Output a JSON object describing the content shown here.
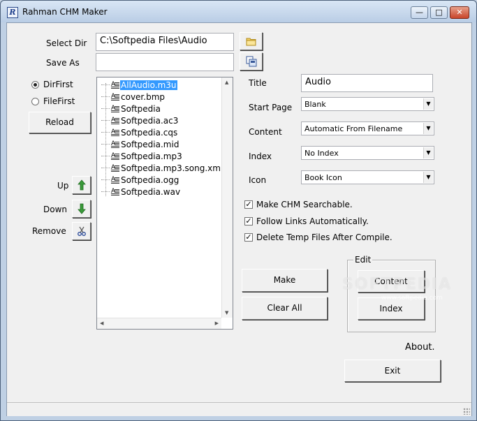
{
  "window": {
    "title": "Rahman CHM Maker",
    "minimize_glyph": "—",
    "maximize_glyph": "□",
    "close_glyph": "✕"
  },
  "left_panel": {
    "select_dir_label": "Select Dir",
    "select_dir_value": "C:\\Softpedia Files\\Audio",
    "save_as_label": "Save As",
    "save_as_value": "",
    "browse_icon": "folder-open-icon",
    "save_icon": "save-copy-icon",
    "sort_options": [
      {
        "label": "DirFirst",
        "selected": true
      },
      {
        "label": "FileFirst",
        "selected": false
      }
    ],
    "reload_label": "Reload",
    "up_label": "Up",
    "down_label": "Down",
    "remove_label": "Remove"
  },
  "file_list": {
    "items": [
      {
        "name": "AllAudio.m3u",
        "selected": true
      },
      {
        "name": "cover.bmp",
        "selected": false
      },
      {
        "name": "Softpedia",
        "selected": false
      },
      {
        "name": "Softpedia.ac3",
        "selected": false
      },
      {
        "name": "Softpedia.cqs",
        "selected": false
      },
      {
        "name": "Softpedia.mid",
        "selected": false
      },
      {
        "name": "Softpedia.mp3",
        "selected": false
      },
      {
        "name": "Softpedia.mp3.song.xml",
        "selected": false
      },
      {
        "name": "Softpedia.ogg",
        "selected": false
      },
      {
        "name": "Softpedia.wav",
        "selected": false
      }
    ]
  },
  "settings": {
    "title_label": "Title",
    "title_value": "Audio",
    "start_page_label": "Start Page",
    "start_page_value": "Blank",
    "content_label": "Content",
    "content_value": "Automatic From Filename",
    "index_label": "Index",
    "index_value": "No Index",
    "icon_label": "Icon",
    "icon_value": "Book Icon",
    "checkboxes": [
      {
        "label": "Make CHM Searchable.",
        "checked": true
      },
      {
        "label": "Follow Links Automatically.",
        "checked": true
      },
      {
        "label": "Delete Temp Files After Compile.",
        "checked": true
      }
    ]
  },
  "actions": {
    "make_label": "Make",
    "clear_all_label": "Clear All",
    "edit_group_label": "Edit",
    "edit_content_label": "Content",
    "edit_index_label": "Index",
    "about_label": "About.",
    "exit_label": "Exit"
  },
  "watermark": {
    "text": "SOFTPEDIA",
    "sub": "www.softpedia.com"
  },
  "colors": {
    "selection": "#3399ff",
    "arrow_green": "#3a9a3a"
  }
}
